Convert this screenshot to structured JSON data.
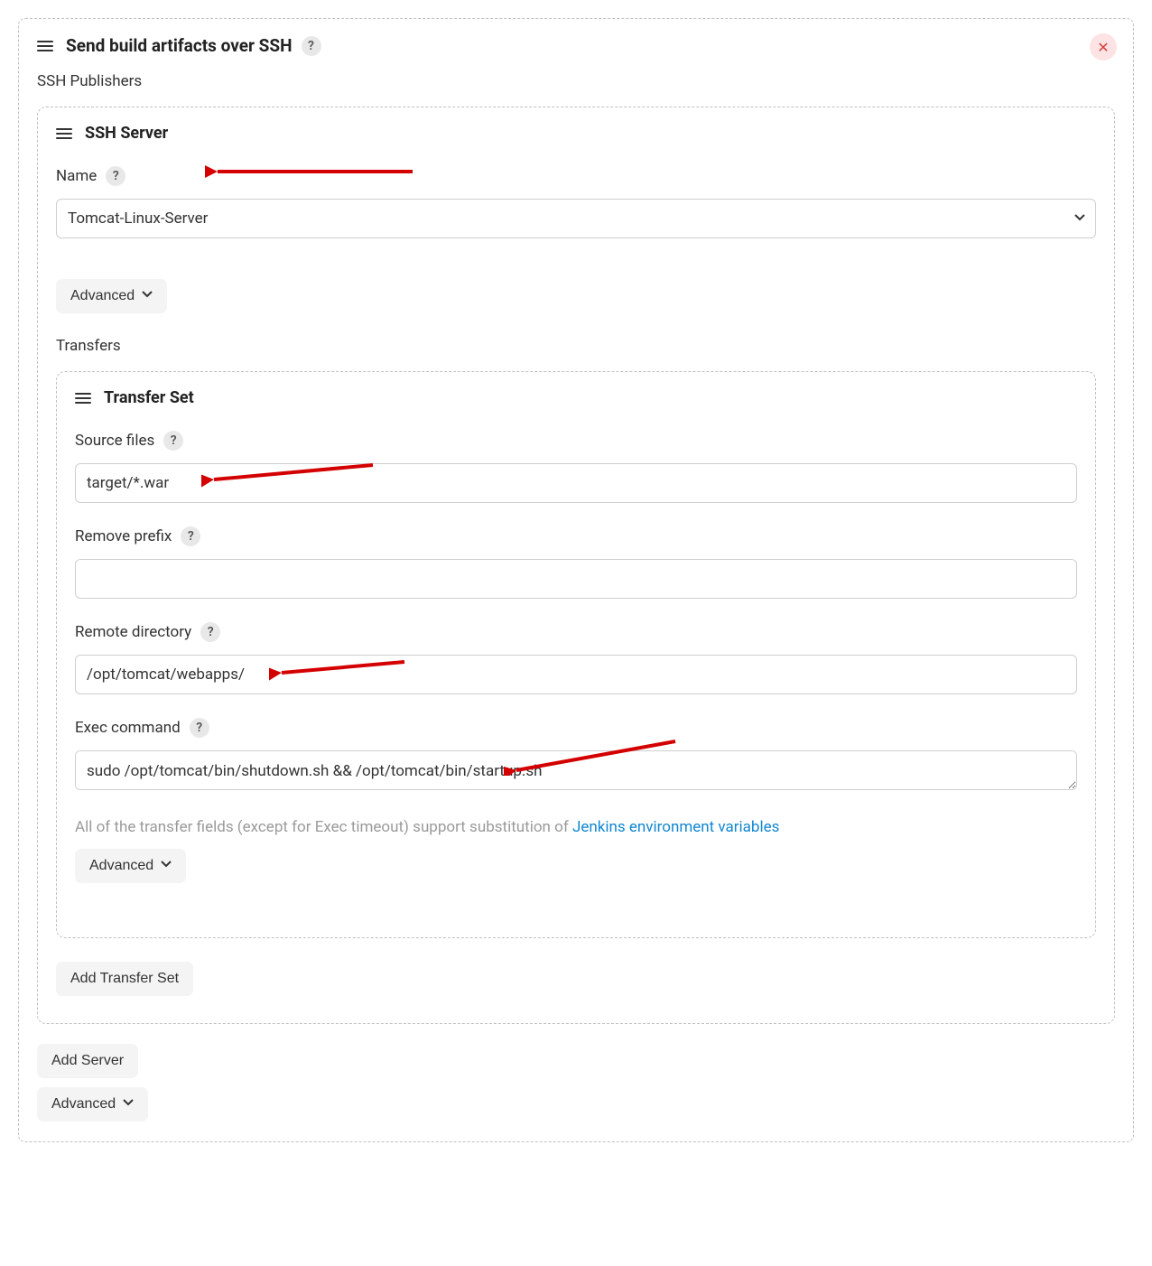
{
  "panel": {
    "title": "Send build artifacts over SSH",
    "help": "?",
    "close": "✕"
  },
  "publishers_label": "SSH Publishers",
  "server": {
    "title": "SSH Server",
    "name_label": "Name",
    "name_help": "?",
    "name_value": "Tomcat-Linux-Server",
    "advanced_label": "Advanced",
    "transfers_label": "Transfers"
  },
  "transfer": {
    "title": "Transfer Set",
    "source_label": "Source files",
    "source_help": "?",
    "source_value": "target/*.war",
    "remove_prefix_label": "Remove prefix",
    "remove_prefix_help": "?",
    "remove_prefix_value": "",
    "remote_dir_label": "Remote directory",
    "remote_dir_help": "?",
    "remote_dir_value": "/opt/tomcat/webapps/",
    "exec_label": "Exec command",
    "exec_help": "?",
    "exec_value": "sudo /opt/tomcat/bin/shutdown.sh && /opt/tomcat/bin/startup.sh",
    "helper_prefix": "All of the transfer fields (except for Exec timeout) support substitution of ",
    "helper_link": "Jenkins environment variables",
    "advanced_label": "Advanced"
  },
  "add_transfer_label": "Add Transfer Set",
  "add_server_label": "Add Server",
  "advanced_bottom_label": "Advanced"
}
